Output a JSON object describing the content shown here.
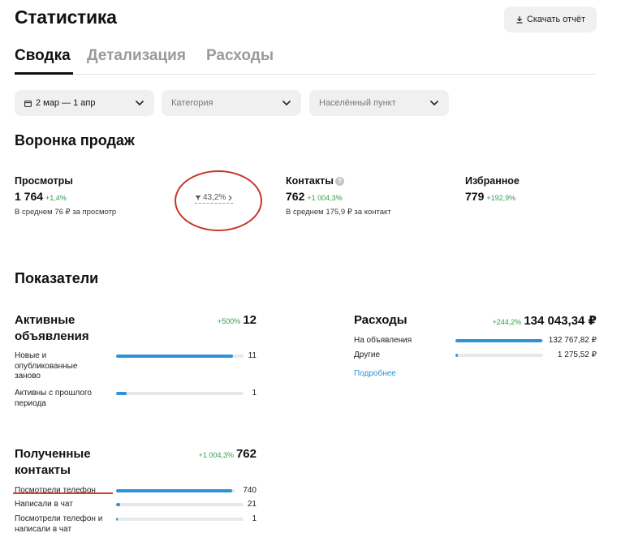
{
  "page": {
    "title": "Статистика",
    "download_label": "Скачать отчёт"
  },
  "tabs": [
    {
      "label": "Сводка",
      "active": true
    },
    {
      "label": "Детализация",
      "active": false
    },
    {
      "label": "Расходы",
      "active": false
    }
  ],
  "filters": {
    "date": "2 мар — 1 апр",
    "category_placeholder": "Категория",
    "location_placeholder": "Населённый пункт"
  },
  "funnel": {
    "title": "Воронка продаж",
    "views": {
      "label": "Просмотры",
      "value": "1 764",
      "change": "+1,4%",
      "avg": "В среднем 76 ₽ за просмотр"
    },
    "conversion": {
      "value": "43,2%"
    },
    "contacts": {
      "label": "Контакты",
      "value": "762",
      "change": "+1 004,3%",
      "avg": "В среднем 175,9 ₽ за контакт"
    },
    "favorites": {
      "label": "Избранное",
      "value": "779",
      "change": "+192,9%"
    }
  },
  "metrics": {
    "title": "Показатели",
    "active_ads": {
      "title": "Активные объявления",
      "change": "+500%",
      "total": "12",
      "rows": [
        {
          "label": "Новые и опубликованные заново",
          "value": "11",
          "fill": 0.92
        },
        {
          "label": "Активны с прошлого периода",
          "value": "1",
          "fill": 0.08
        }
      ]
    },
    "expenses": {
      "title": "Расходы",
      "change": "+244,2%",
      "total": "134 043,34 ₽",
      "rows": [
        {
          "label": "На объявления",
          "value": "132 767,82 ₽",
          "fill": 0.99
        },
        {
          "label": "Другие",
          "value": "1 275,52 ₽",
          "fill": 0.03
        }
      ],
      "more_link": "Подробнее"
    },
    "received_contacts": {
      "title": "Полученные контакты",
      "change": "+1 004,3%",
      "total": "762",
      "rows": [
        {
          "label": "Посмотрели телефон",
          "value": "740",
          "fill": 0.97
        },
        {
          "label": "Написали в чат",
          "value": "21",
          "fill": 0.03
        },
        {
          "label": "Посмотрели телефон и написали в чат",
          "value": "1",
          "fill": 0.01
        }
      ]
    }
  },
  "colors": {
    "accent_blue": "#2b93d6",
    "positive_green": "#2e9e48",
    "annotation_red": "#c8352a"
  },
  "icons": {
    "download": "download-icon",
    "calendar": "calendar-icon",
    "chevron": "chevron-down-icon",
    "funnel": "funnel-icon",
    "help": "question-icon"
  }
}
